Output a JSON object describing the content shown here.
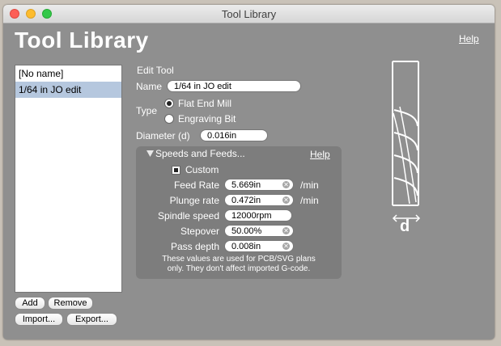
{
  "window": {
    "title": "Tool Library"
  },
  "header": {
    "title": "Tool Library",
    "help": "Help"
  },
  "tool_list": {
    "items": [
      "[No name]",
      "1/64 in JO edit"
    ],
    "selected": 1
  },
  "buttons": {
    "add": "Add",
    "remove": "Remove",
    "import": "Import...",
    "export": "Export..."
  },
  "edit_tool": {
    "heading": "Edit Tool",
    "name_label": "Name",
    "name_value": "1/64 in JO edit",
    "type_label": "Type",
    "type_options": [
      "Flat End Mill",
      "Engraving Bit"
    ],
    "type_selected": "Flat End Mill",
    "diameter_label": "Diameter (d)",
    "diameter_value": "0.016in"
  },
  "speeds": {
    "heading": "Speeds and Feeds...",
    "help": "Help",
    "custom_label": "Custom",
    "custom_checked": true,
    "feed_rate_label": "Feed Rate",
    "feed_rate_value": "5.669in",
    "feed_rate_unit": "/min",
    "plunge_rate_label": "Plunge rate",
    "plunge_rate_value": "0.472in",
    "plunge_rate_unit": "/min",
    "spindle_label": "Spindle speed",
    "spindle_value": "12000rpm",
    "stepover_label": "Stepover",
    "stepover_value": "50.00%",
    "pass_depth_label": "Pass depth",
    "pass_depth_value": "0.008in",
    "note_line1": "These values are used for PCB/SVG plans",
    "note_line2": "only. They don't affect imported G-code."
  },
  "diagram": {
    "dimension_label": "d"
  },
  "icons": {
    "clear": "clear-icon",
    "disclosure": "disclosure-triangle-icon"
  }
}
